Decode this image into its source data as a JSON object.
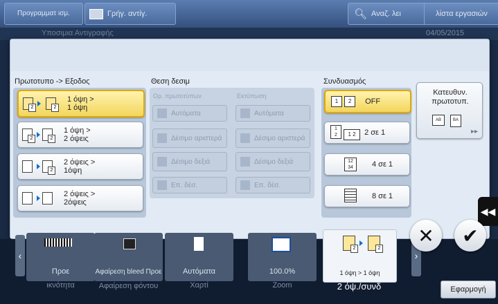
{
  "topbar": {
    "programs": "Προγραμματ ισμ.",
    "quick_copy": "Γρήγ. αντίγ.",
    "search": "Αναζ. λει",
    "jobs": "λίστα εργασιών",
    "behind_title": "Υποσιμια Αντιγραφής",
    "behind_date": "04/05/2015"
  },
  "groups": {
    "original_output": "Πρωτοτυπο -> Εξοδος",
    "binding_position": "Θεση δεσιμ",
    "combination": "Συνδυασμός"
  },
  "duplex_options": [
    {
      "label": "1 όψη >\n1 όψη",
      "selected": true
    },
    {
      "label": "1 όψη >\n2 όψεις",
      "selected": false
    },
    {
      "label": "2 όψεις >\n1όψη",
      "selected": false
    },
    {
      "label": "2 όψεις >\n2όψεις",
      "selected": false
    }
  ],
  "binding": {
    "original_header": "Ορ. πρωτοτύπων",
    "print_header": "Εκτύπωση",
    "buttons": [
      "Αυτόματα",
      "Δέσιμο αριστερά",
      "Δέσιμο δεξιά",
      "Επ. δέσ."
    ]
  },
  "combine_options": [
    {
      "label": "OFF",
      "selected": true
    },
    {
      "label": "2 σε 1",
      "selected": false
    },
    {
      "label": "4 σε 1",
      "selected": false
    },
    {
      "label": "8 σε 1",
      "selected": false
    }
  ],
  "direction": {
    "label": "Κατευθυν. πρωτοτυπ."
  },
  "bottom_tiles": [
    {
      "label": "Προε",
      "caption": "ικνότητα"
    },
    {
      "label": "Αφαίρεση bleed Προε",
      "caption": "Αφαίρεση φόντου"
    },
    {
      "label": "Αυτόματα",
      "caption": "Χαρτί"
    },
    {
      "label": "100.0%",
      "caption": "Zoom"
    },
    {
      "label": "1 όψη > 1 όψη",
      "caption": "2 όψ./συνδ"
    }
  ],
  "apply_label": "Εφαρμογή"
}
